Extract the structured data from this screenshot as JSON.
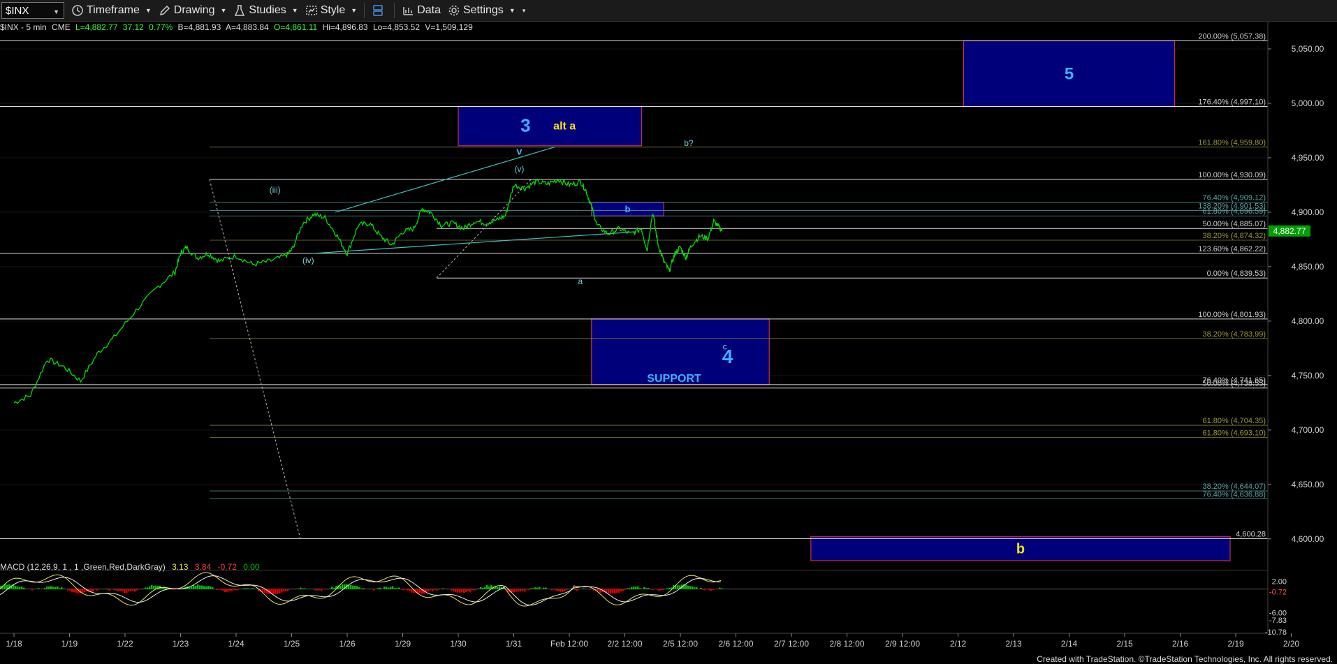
{
  "toolbar": {
    "symbol": "$INX",
    "timeframe_label": "Timeframe",
    "drawing_label": "Drawing",
    "studies_label": "Studies",
    "style_label": "Style",
    "data_label": "Data",
    "settings_label": "Settings"
  },
  "infobar": {
    "symbol": "$INX - 5 min",
    "exchange": "CME",
    "last": "L=4,882.77",
    "change": "37.12",
    "change_pct": "0.77%",
    "bid": "B=4,881.93",
    "ask": "A=4,883.84",
    "open": "O=4,861.11",
    "high": "Hi=4,896.83",
    "low": "Lo=4,853.52",
    "volume": "V=1,509,129"
  },
  "macd": {
    "label": "MACD (12,26,9, 1 , 1 ,Green,Red,DarkGray)",
    "v1": "3.13",
    "v2": "3.84",
    "v3": "-0.72",
    "v4": "0.00",
    "axis_labels": [
      "2.00",
      "-0.72",
      "-6.00",
      "-7.83",
      "-10.78"
    ]
  },
  "footer": "Created with TradeStation. ©TradeStation Technologies, Inc. All rights reserved.",
  "colors": {
    "background": "#000000",
    "price": "#00e000",
    "fib_white": "#ffffff",
    "fib_olive": "#9a9a3a",
    "fib_teal": "#5aa6a6",
    "box_fill": "#00007a",
    "box_border": "#c4304a",
    "label_blue": "#3fb0ff",
    "label_yellow": "#ffe020",
    "last_price_bg": "#00a000"
  },
  "chart_data": {
    "type": "line",
    "symbol": "$INX",
    "interval": "5 min",
    "ylim": [
      4580,
      5075
    ],
    "y_axis_ticks": [
      4600,
      4650,
      4700,
      4750,
      4800,
      4850,
      4900,
      4950,
      5000,
      5050
    ],
    "y_axis_tick_labels": [
      "4,600.00",
      "4,650.00",
      "4,700.00",
      "4,750.00",
      "4,800.00",
      "4,850.00",
      "4,900.00",
      "4,950.00",
      "5,000.00",
      "5,050.00"
    ],
    "x_axis_tick_labels": [
      "1/18",
      "1/19",
      "1/22",
      "1/23",
      "1/24",
      "1/25",
      "1/26",
      "1/29",
      "1/30",
      "1/31",
      "Feb 12:00",
      "2/2 12:00",
      "2/5 12:00",
      "2/6 12:00",
      "2/7 12:00",
      "2/8 12:00",
      "2/9 12:00",
      "2/12",
      "2/13",
      "2/14",
      "2/15",
      "2/16",
      "2/19",
      "2/20"
    ],
    "last_price": 4882.77,
    "last_price_label": "4,882.77",
    "price_series": [
      [
        0,
        4725
      ],
      [
        0.3,
        4732
      ],
      [
        0.6,
        4765
      ],
      [
        0.9,
        4758
      ],
      [
        1.2,
        4745
      ],
      [
        1.5,
        4770
      ],
      [
        1.8,
        4785
      ],
      [
        2.2,
        4810
      ],
      [
        2.6,
        4832
      ],
      [
        2.9,
        4845
      ],
      [
        3.0,
        4862
      ],
      [
        3.1,
        4868
      ],
      [
        3.3,
        4858
      ],
      [
        3.5,
        4862
      ],
      [
        3.7,
        4855
      ],
      [
        4.0,
        4860
      ],
      [
        4.3,
        4852
      ],
      [
        4.6,
        4855
      ],
      [
        4.9,
        4860
      ],
      [
        5.0,
        4865
      ],
      [
        5.2,
        4890
      ],
      [
        5.4,
        4898
      ],
      [
        5.6,
        4895
      ],
      [
        5.8,
        4880
      ],
      [
        6.0,
        4862
      ],
      [
        6.2,
        4888
      ],
      [
        6.4,
        4890
      ],
      [
        6.6,
        4878
      ],
      [
        6.8,
        4870
      ],
      [
        7.0,
        4882
      ],
      [
        7.2,
        4885
      ],
      [
        7.35,
        4903
      ],
      [
        7.5,
        4900
      ],
      [
        7.7,
        4888
      ],
      [
        7.9,
        4890
      ],
      [
        8.1,
        4885
      ],
      [
        8.3,
        4892
      ],
      [
        8.5,
        4890
      ],
      [
        8.7,
        4893
      ],
      [
        8.85,
        4897
      ],
      [
        9.0,
        4925
      ],
      [
        9.2,
        4922
      ],
      [
        9.4,
        4928
      ],
      [
        9.6,
        4926
      ],
      [
        9.8,
        4930
      ],
      [
        10.0,
        4925
      ],
      [
        10.2,
        4928
      ],
      [
        10.3,
        4920
      ],
      [
        10.4,
        4905
      ],
      [
        10.5,
        4888
      ],
      [
        10.7,
        4880
      ],
      [
        10.9,
        4885
      ],
      [
        11.1,
        4880
      ],
      [
        11.3,
        4885
      ],
      [
        11.4,
        4865
      ],
      [
        11.5,
        4900
      ],
      [
        11.6,
        4870
      ],
      [
        11.7,
        4855
      ],
      [
        11.8,
        4846
      ],
      [
        11.9,
        4862
      ],
      [
        12.0,
        4868
      ],
      [
        12.1,
        4858
      ],
      [
        12.2,
        4870
      ],
      [
        12.35,
        4878
      ],
      [
        12.5,
        4876
      ],
      [
        12.6,
        4892
      ],
      [
        12.7,
        4886
      ],
      [
        12.75,
        4882.77
      ]
    ],
    "fib_levels": [
      {
        "label": "200.00% (5,057.38)",
        "value": 5057.38,
        "color": "white"
      },
      {
        "label": "176.40% (4,997.10)",
        "value": 4997.1,
        "color": "white"
      },
      {
        "label": "161.80% (4,959.80)",
        "value": 4959.8,
        "color": "olive"
      },
      {
        "label": "100.00% (4,930.09)",
        "value": 4930.09,
        "color": "white"
      },
      {
        "label": "76.40% (4,909.12)",
        "value": 4909.12,
        "color": "teal"
      },
      {
        "label": "138.20% (4,901.53)",
        "value": 4901.53,
        "color": "teal"
      },
      {
        "label": "61.80% (4,896.59)",
        "value": 4896.59,
        "color": "teal"
      },
      {
        "label": "50.00% (4,885.07)",
        "value": 4885.07,
        "color": "white"
      },
      {
        "label": "38.20% (4,874.32)",
        "value": 4874.32,
        "color": "olive"
      },
      {
        "label": "123.60% (4,862.22)",
        "value": 4862.22,
        "color": "white"
      },
      {
        "label": "0.00% (4,839.53)",
        "value": 4839.53,
        "color": "white"
      },
      {
        "label": "100.00% (4,801.93)",
        "value": 4801.93,
        "color": "white"
      },
      {
        "label": "38.20% (4,783.99)",
        "value": 4783.99,
        "color": "olive"
      },
      {
        "label": "76.40% (4,741.65)",
        "value": 4741.65,
        "color": "white"
      },
      {
        "label": "50.00% (4,738.55)",
        "value": 4738.55,
        "color": "white"
      },
      {
        "label": "61.80% (4,704.35)",
        "value": 4704.35,
        "color": "olive"
      },
      {
        "label": "61.80% (4,693.10)",
        "value": 4693.1,
        "color": "olive"
      },
      {
        "label": "38.20% (4,644.07)",
        "value": 4644.07,
        "color": "teal"
      },
      {
        "label": "76.40% (4,636.88)",
        "value": 4636.88,
        "color": "teal"
      },
      {
        "label": "4,600.28",
        "value": 4600.28,
        "color": "white"
      }
    ],
    "target_boxes": [
      {
        "label": "5",
        "x0": 17.1,
        "x1": 20.9,
        "y0": 4997.1,
        "y1": 5057.38,
        "label_color": "blue"
      },
      {
        "label": "3",
        "label2": "alt a",
        "x0": 8.0,
        "x1": 11.3,
        "y0": 4961,
        "y1": 4997.1,
        "label_color": "blue"
      },
      {
        "label": "b",
        "x0": 10.4,
        "x1": 11.7,
        "y0": 4896.59,
        "y1": 4909.12,
        "label_color": "blue"
      },
      {
        "label": "4",
        "label2": "SUPPORT",
        "x0": 10.4,
        "x1": 13.6,
        "y0": 4741.65,
        "y1": 4801.93,
        "label_color": "blue"
      },
      {
        "label": "b",
        "x0": 14.35,
        "x1": 21.9,
        "y0": 4580,
        "y1": 4602,
        "label_color": "yellow"
      }
    ],
    "wave_labels": [
      {
        "text": "(iii)",
        "x": 4.7,
        "y": 4918
      },
      {
        "text": "(iv)",
        "x": 5.3,
        "y": 4853
      },
      {
        "text": "v",
        "x": 9.1,
        "y": 4953
      },
      {
        "text": "(v)",
        "x": 9.1,
        "y": 4937
      },
      {
        "text": "b?",
        "x": 12.15,
        "y": 4961
      },
      {
        "text": "a",
        "x": 10.2,
        "y": 4834
      },
      {
        "text": "c",
        "x": 12.8,
        "y": 4774
      }
    ],
    "macd_series": [
      3.13,
      3.84,
      -0.72,
      0.0
    ]
  }
}
